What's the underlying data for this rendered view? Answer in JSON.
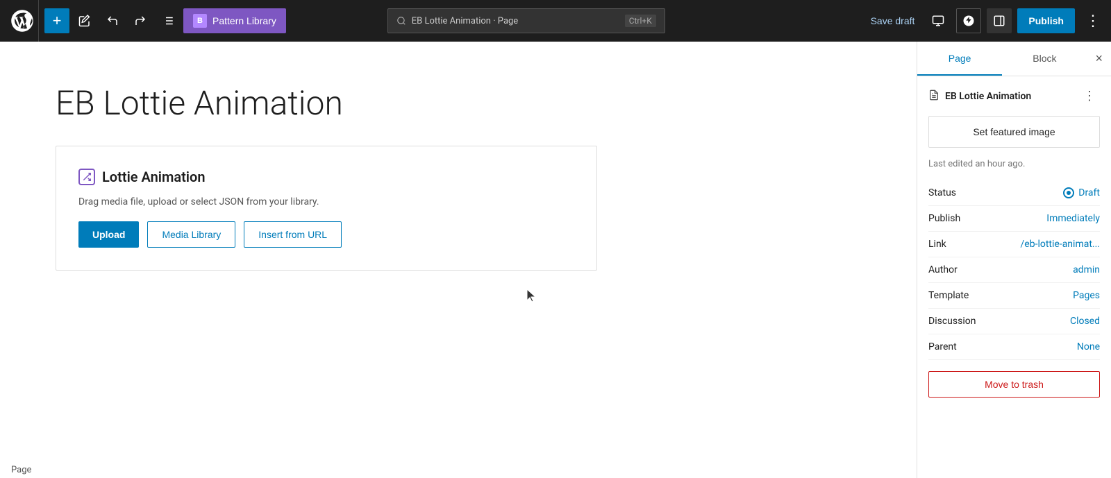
{
  "toolbar": {
    "wp_logo_label": "WordPress",
    "add_button_label": "+",
    "edit_button_label": "✏",
    "undo_label": "←",
    "redo_label": "→",
    "list_view_label": "≡",
    "pattern_library_label": "Pattern Library",
    "pattern_lib_icon_label": "B",
    "search_placeholder": "EB Lottie Animation · Page",
    "search_shortcut": "Ctrl+K",
    "save_draft_label": "Save draft",
    "view_icon_label": "□",
    "jetpack_icon_label": "J",
    "sidebar_icon_label": "⊞",
    "publish_label": "Publish",
    "more_label": "⋮"
  },
  "editor": {
    "page_title": "EB Lottie Animation",
    "block": {
      "icon_label": "◇",
      "title": "Lottie Animation",
      "description": "Drag media file, upload or select JSON from your library.",
      "upload_label": "Upload",
      "media_library_label": "Media Library",
      "insert_url_label": "Insert from URL"
    }
  },
  "status_bar": {
    "label": "Page"
  },
  "sidebar": {
    "tab_page": "Page",
    "tab_block": "Block",
    "close_label": "×",
    "page_label": "EB Lottie Animation",
    "more_label": "⋮",
    "set_featured_image": "Set featured image",
    "last_edited": "Last edited an hour ago.",
    "meta": [
      {
        "label": "Status",
        "value": "Draft",
        "type": "status"
      },
      {
        "label": "Publish",
        "value": "Immediately"
      },
      {
        "label": "Link",
        "value": "/eb-lottie-animat..."
      },
      {
        "label": "Author",
        "value": "admin"
      },
      {
        "label": "Template",
        "value": "Pages"
      },
      {
        "label": "Discussion",
        "value": "Closed"
      },
      {
        "label": "Parent",
        "value": "None"
      }
    ],
    "delete_label": "Move to trash"
  }
}
